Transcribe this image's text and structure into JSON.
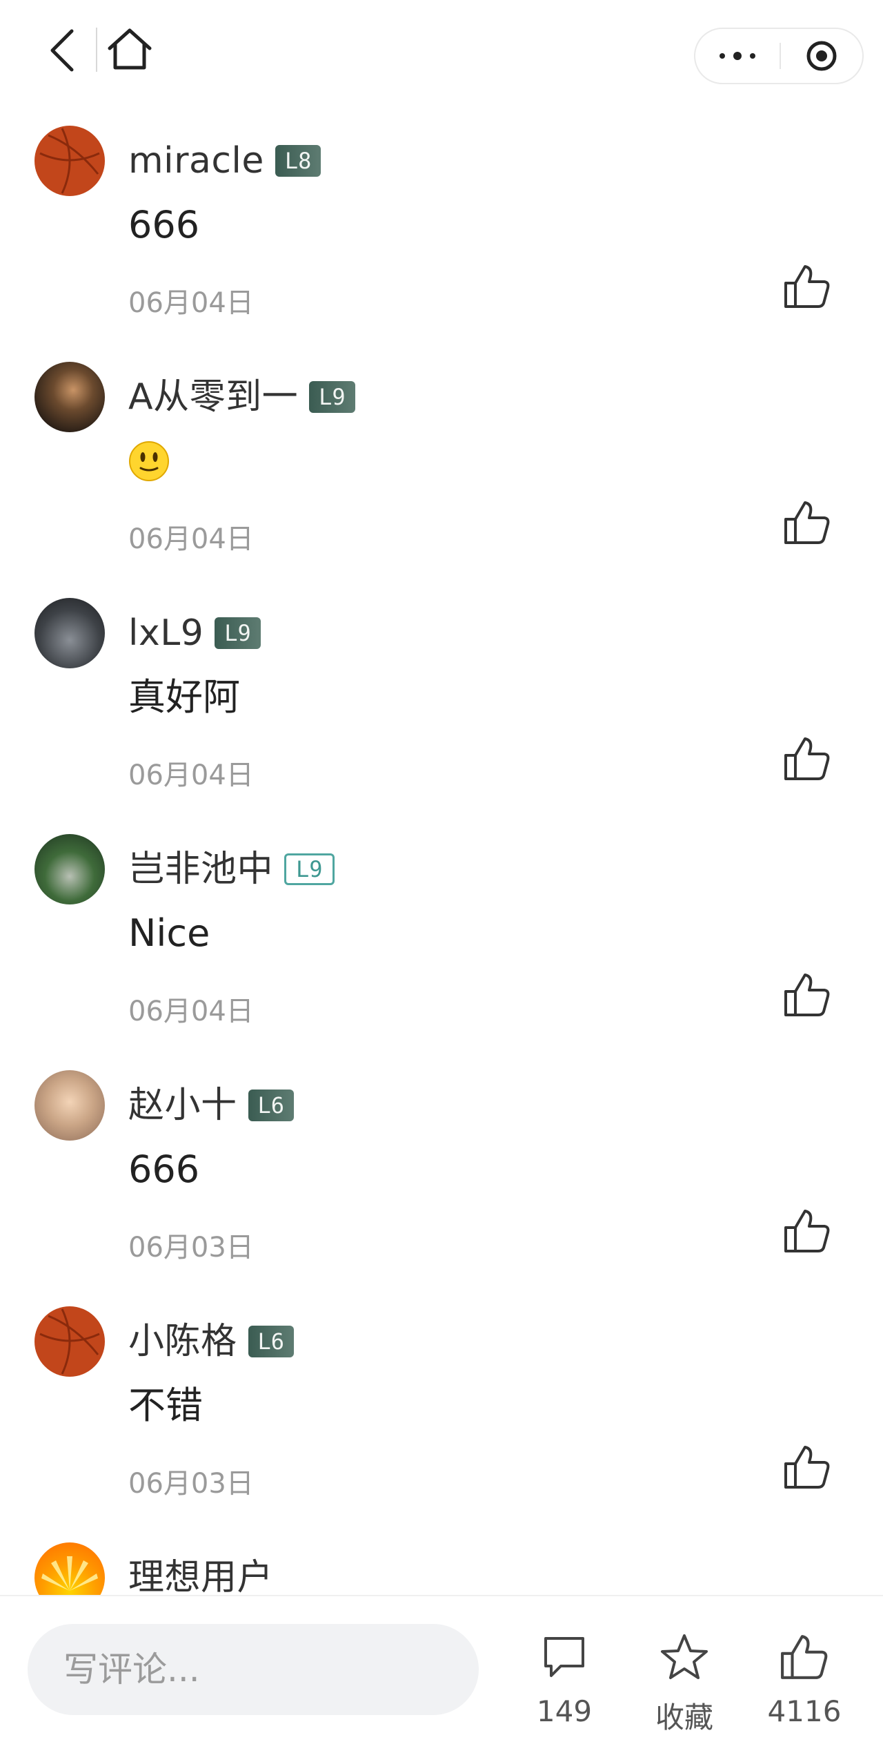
{
  "nav": {
    "back_icon": "chevron-left-icon",
    "home_icon": "home-icon",
    "more_icon": "more-dots-icon",
    "close_icon": "target-icon"
  },
  "comments": [
    {
      "username": "miracle",
      "level": "L8",
      "text": "666",
      "date": "06月04日",
      "avatar": "basketball"
    },
    {
      "username": "A从零到一",
      "level": "L9",
      "text": "",
      "emoji": "slightly-smiling-face",
      "date": "06月04日",
      "avatar": "photo"
    },
    {
      "username": "lxL9",
      "level": "L9",
      "text": "真好阿",
      "date": "06月04日",
      "avatar": "photo"
    },
    {
      "username": "岂非池中",
      "level": "L9",
      "level_style": "outline",
      "text": "Nice",
      "date": "06月04日",
      "avatar": "photo"
    },
    {
      "username": "赵小十",
      "level": "L6",
      "text": "666",
      "date": "06月03日",
      "avatar": "photo"
    },
    {
      "username": "小陈格",
      "level": "L6",
      "text": "不错",
      "date": "06月03日",
      "avatar": "basketball"
    },
    {
      "username": "理想用户",
      "avatar": "sun"
    }
  ],
  "bottom": {
    "input_placeholder": "写评论...",
    "comment_count": "149",
    "favorite_label": "收藏",
    "like_count": "4116"
  },
  "colors": {
    "level_badge": "#4a6b61",
    "level_badge_outline": "#4fa6a0",
    "date_gray": "#9a9a9a",
    "input_bg": "#f1f2f4"
  }
}
